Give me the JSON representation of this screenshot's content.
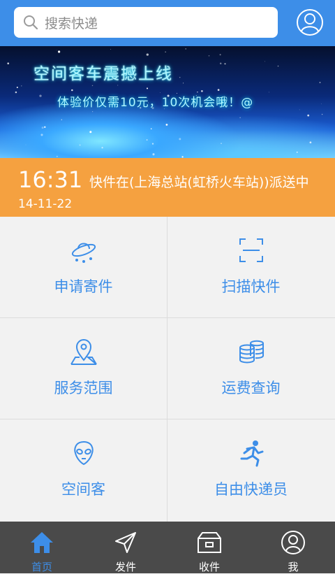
{
  "search": {
    "placeholder": "搜索快递"
  },
  "banner": {
    "headline": "空间客车震撼上线",
    "subline": "体验价仅需10元，10次机会哦！@"
  },
  "status": {
    "time": "16:31",
    "date": "14-11-22",
    "message": "快件在(上海总站(虹桥火车站))派送中"
  },
  "grid": {
    "items": [
      {
        "label": "申请寄件",
        "icon": "ufo-icon"
      },
      {
        "label": "扫描快件",
        "icon": "scan-icon"
      },
      {
        "label": "服务范围",
        "icon": "map-pin-icon"
      },
      {
        "label": "运费查询",
        "icon": "coins-icon"
      },
      {
        "label": "空间客",
        "icon": "alien-icon"
      },
      {
        "label": "自由快递员",
        "icon": "runner-icon"
      }
    ]
  },
  "tabbar": {
    "items": [
      {
        "label": "首页",
        "icon": "home-icon",
        "active": true
      },
      {
        "label": "发件",
        "icon": "send-icon",
        "active": false
      },
      {
        "label": "收件",
        "icon": "inbox-icon",
        "active": false
      },
      {
        "label": "我",
        "icon": "user-icon",
        "active": false
      }
    ]
  },
  "colors": {
    "accent": "#3d8ee8",
    "status_bg": "#f5a140",
    "tabbar_bg": "#4a4a4a"
  }
}
